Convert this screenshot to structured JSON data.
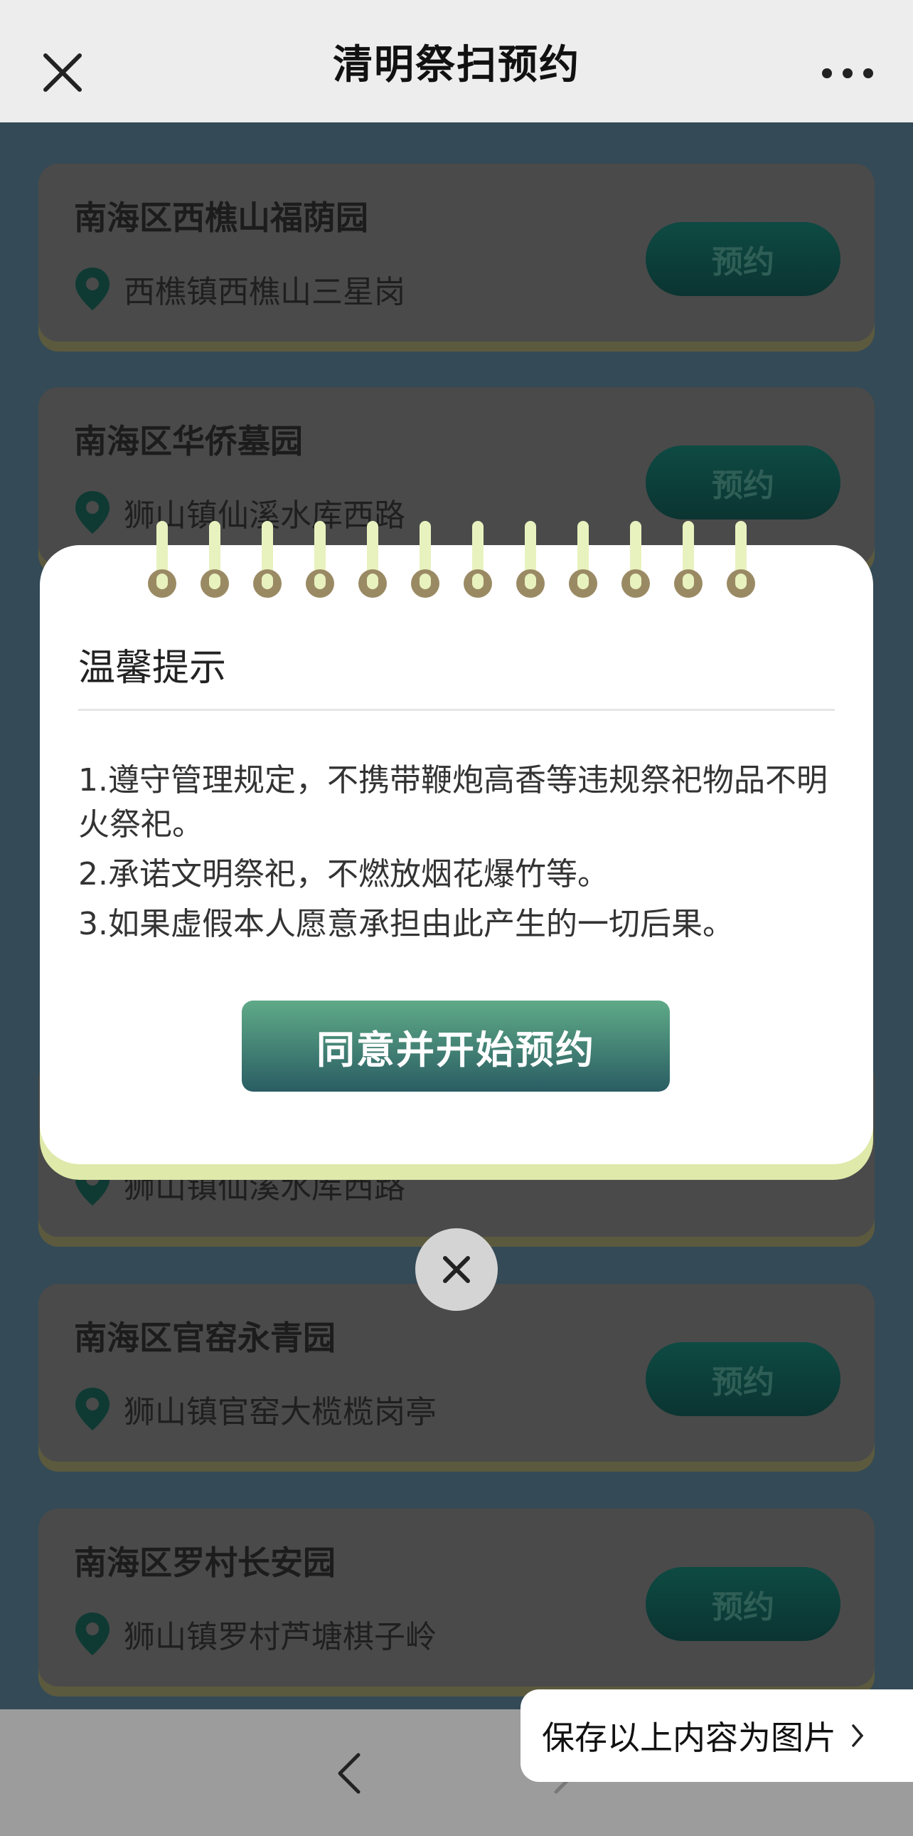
{
  "header": {
    "title": "清明祭扫预约"
  },
  "cemeteries": [
    {
      "name": "南海区西樵山福荫园",
      "address": "西樵镇西樵山三星岗",
      "button": "预约"
    },
    {
      "name": "南海区华侨墓园",
      "address": "狮山镇仙溪水库西路",
      "button": "预约"
    },
    {
      "name": "",
      "address": "狮山镇仙溪水库西路",
      "button": ""
    },
    {
      "name": "南海区官窑永青园",
      "address": "狮山镇官窑大榄榄岗亭",
      "button": "预约"
    },
    {
      "name": "南海区罗村长安园",
      "address": "狮山镇罗村芦塘棋子岭",
      "button": "预约"
    }
  ],
  "dialog": {
    "heading": "温馨提示",
    "rules": [
      "1.遵守管理规定，不携带鞭炮高香等违规祭祀物品不明火祭祀。",
      "2.承诺文明祭祀，不燃放烟花爆竹等。",
      "3.如果虚假本人愿意承担由此产生的一切后果。"
    ],
    "agree_button": "同意并开始预约"
  },
  "save_pill": {
    "label": "保存以上内容为图片"
  },
  "colors": {
    "accent": "#2a5d63",
    "overlay": "#344a56",
    "binding": "#e8f2bf"
  }
}
